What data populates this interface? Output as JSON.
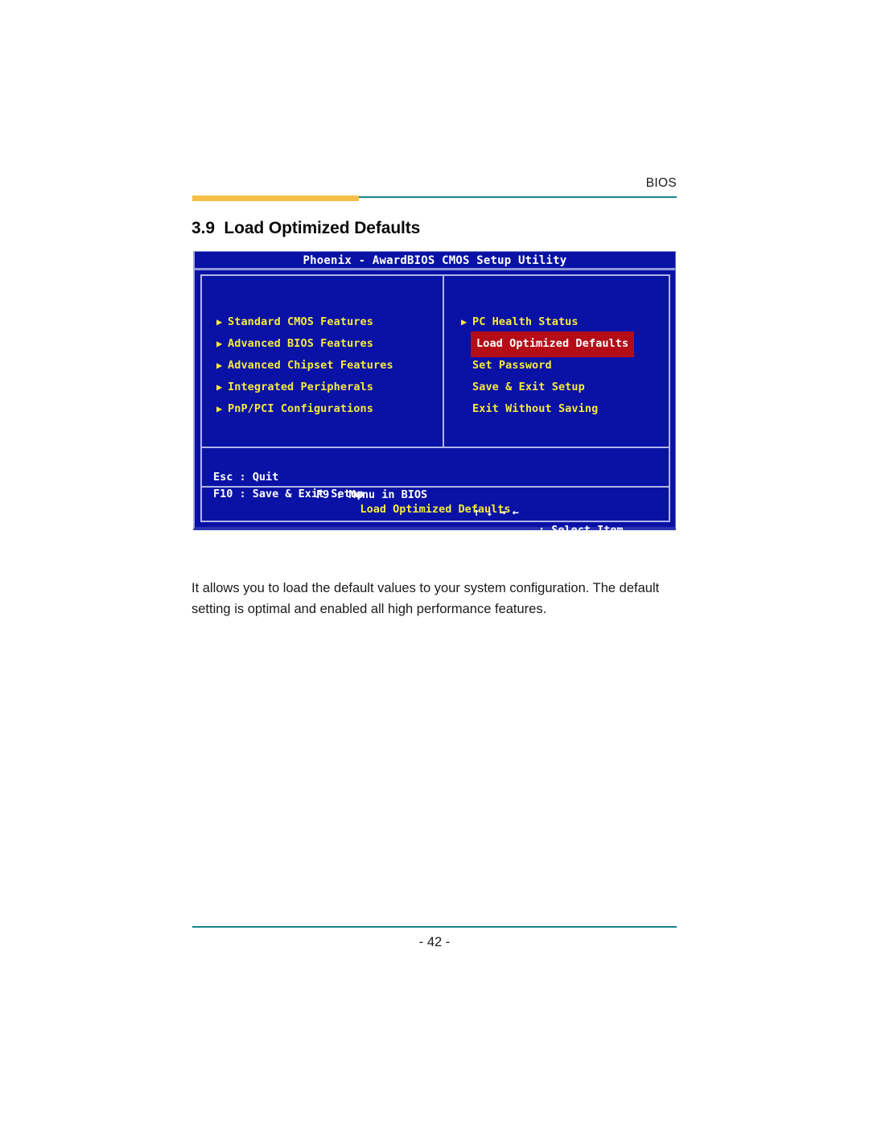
{
  "header": {
    "label": "BIOS",
    "rule_orange": "#f6bf45",
    "rule_teal": "#17858c"
  },
  "section": {
    "number": "3.9",
    "title": "Load Optimized Defaults",
    "heading": "3.9  Load Optimized Defaults"
  },
  "bios": {
    "title": "Phoenix - AwardBIOS CMOS Setup Utility",
    "background_color": "#0a11a5",
    "text_color": "#f5ea3c",
    "highlight_color": "#b40d17",
    "border_color": "#b0b6e8",
    "left_menu": [
      {
        "bullet": "▶",
        "label": "Standard CMOS Features",
        "selected": false
      },
      {
        "bullet": "▶",
        "label": "Advanced BIOS Features",
        "selected": false
      },
      {
        "bullet": "▶",
        "label": "Advanced Chipset Features",
        "selected": false
      },
      {
        "bullet": "▶",
        "label": "Integrated Peripherals",
        "selected": false
      },
      {
        "bullet": "▶",
        "label": "PnP/PCI Configurations",
        "selected": false
      }
    ],
    "right_menu": [
      {
        "bullet": "▶",
        "label": "PC Health Status",
        "selected": false
      },
      {
        "bullet": "",
        "label": "Load Optimized Defaults",
        "selected": true
      },
      {
        "bullet": "",
        "label": "Set Password",
        "selected": false
      },
      {
        "bullet": "",
        "label": "Save & Exit Setup",
        "selected": false
      },
      {
        "bullet": "",
        "label": "Exit Without Saving",
        "selected": false
      }
    ],
    "help": {
      "esc": "Esc : Quit",
      "f9": "F9 : Menu in BIOS",
      "arrows": "↑ ↓ → ←",
      "select_item": ": Select Item",
      "f10": "F10 : Save & Exit Setup"
    },
    "footer_message": "Load Optimized Defaults"
  },
  "body": {
    "paragraph": "It allows you to load the default values to your system configuration. The default setting is optimal and enabled all high performance features."
  },
  "footer": {
    "page_number": "- 42 -"
  }
}
